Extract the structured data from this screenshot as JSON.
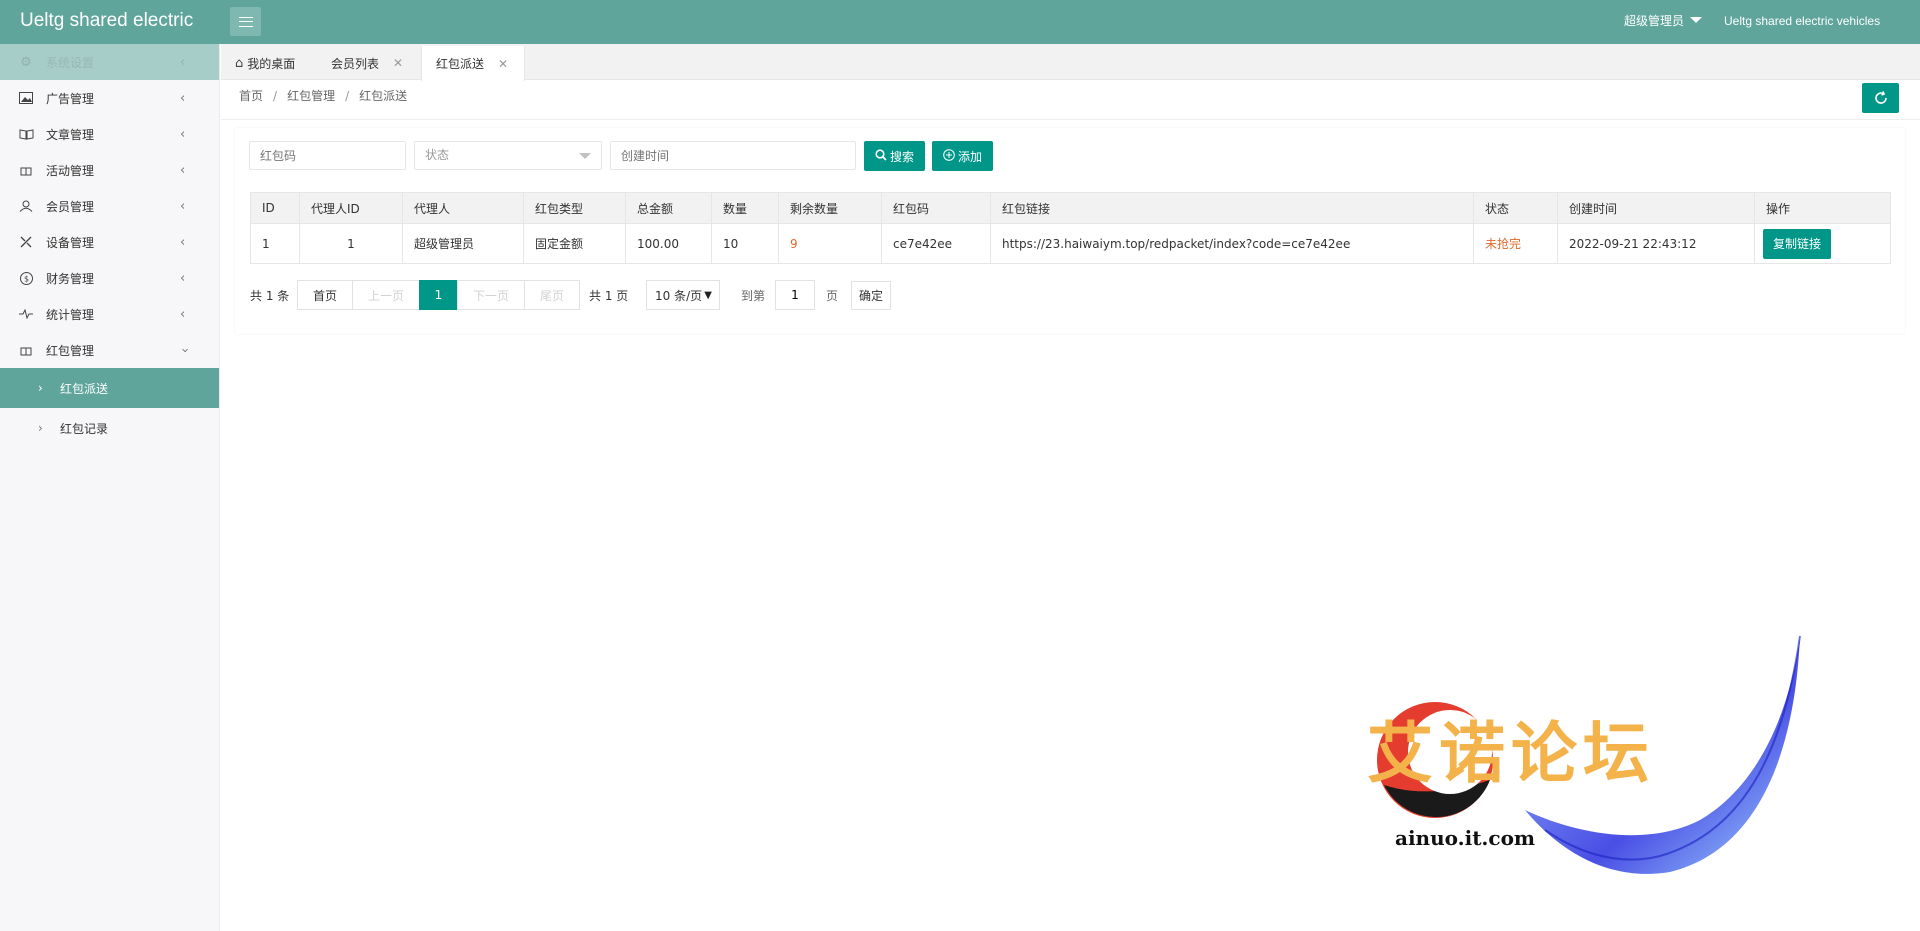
{
  "header": {
    "logo": "Ueltg shared electric",
    "user": "超级管理员",
    "site_name": "Ueltg shared electric vehicles"
  },
  "sidebar": {
    "items": [
      {
        "label": "系统设置",
        "icon": "gear-icon"
      },
      {
        "label": "广告管理",
        "icon": "image-icon"
      },
      {
        "label": "文章管理",
        "icon": "book-icon"
      },
      {
        "label": "活动管理",
        "icon": "gift-icon"
      },
      {
        "label": "会员管理",
        "icon": "users-icon"
      },
      {
        "label": "设备管理",
        "icon": "tools-icon"
      },
      {
        "label": "财务管理",
        "icon": "dollar-icon"
      },
      {
        "label": "统计管理",
        "icon": "pulse-icon"
      },
      {
        "label": "红包管理",
        "icon": "gift-icon"
      }
    ],
    "sub_items": [
      {
        "label": "红包派送",
        "active": true
      },
      {
        "label": "红包记录",
        "active": false
      }
    ]
  },
  "tabs": [
    {
      "label": "我的桌面"
    },
    {
      "label": "会员列表"
    },
    {
      "label": "红包派送"
    }
  ],
  "breadcrumb": [
    "首页",
    "红包管理",
    "红包派送"
  ],
  "filters": {
    "code_placeholder": "红包码",
    "status_placeholder": "状态",
    "time_placeholder": "创建时间",
    "search_label": "搜索",
    "add_label": "添加"
  },
  "table": {
    "headers": [
      "ID",
      "代理人ID",
      "代理人",
      "红包类型",
      "总金额",
      "数量",
      "剩余数量",
      "红包码",
      "红包链接",
      "状态",
      "创建时间",
      "操作"
    ],
    "rows": [
      {
        "id": "1",
        "agent_id": "1",
        "agent": "超级管理员",
        "type": "固定金额",
        "total": "100.00",
        "count": "10",
        "remaining": "9",
        "code": "ce7e42ee",
        "link": "https://23.haiwaiym.top/redpacket/index?code=ce7e42ee",
        "status": "未抢完",
        "created": "2022-09-21 22:43:12",
        "action": "复制链接"
      }
    ]
  },
  "pagination": {
    "total": "共 1 条",
    "first": "首页",
    "prev": "上一页",
    "current": "1",
    "next": "下一页",
    "last": "尾页",
    "pages": "共 1 页",
    "per_page": "10 条/页",
    "goto": "到第",
    "page_value": "1",
    "page_unit": "页",
    "confirm": "确定"
  },
  "watermark": {
    "text": "艾诺论坛",
    "url": "ainuo.it.com"
  },
  "colors": {
    "header": "#5fa59c",
    "primary": "#009688",
    "orange": "#e06a2e"
  }
}
